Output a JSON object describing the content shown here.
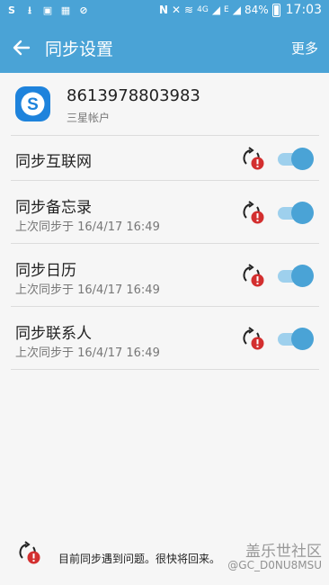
{
  "status_bar": {
    "battery": "84%",
    "time": "17:03",
    "network": "4G",
    "signal_label": "E"
  },
  "app_bar": {
    "title": "同步设置",
    "more": "更多"
  },
  "account": {
    "number": "8613978803983",
    "type": "三星帐户"
  },
  "rows": [
    {
      "title": "同步互联网",
      "subtitle": "",
      "enabled": true
    },
    {
      "title": "同步备忘录",
      "subtitle": "上次同步于 16/4/17  16:49",
      "enabled": true
    },
    {
      "title": "同步日历",
      "subtitle": "上次同步于 16/4/17  16:49",
      "enabled": true
    },
    {
      "title": "同步联系人",
      "subtitle": "上次同步于 16/4/17  16:49",
      "enabled": true
    }
  ],
  "footer": {
    "message": "目前同步遇到问题。很快将回来。",
    "watermark_title": "盖乐世社区",
    "watermark_user": "@GC_D0NU8MSU"
  },
  "colors": {
    "accent": "#4aa3d6",
    "toggle_track": "#9ed0ed",
    "error": "#d32f2f"
  }
}
